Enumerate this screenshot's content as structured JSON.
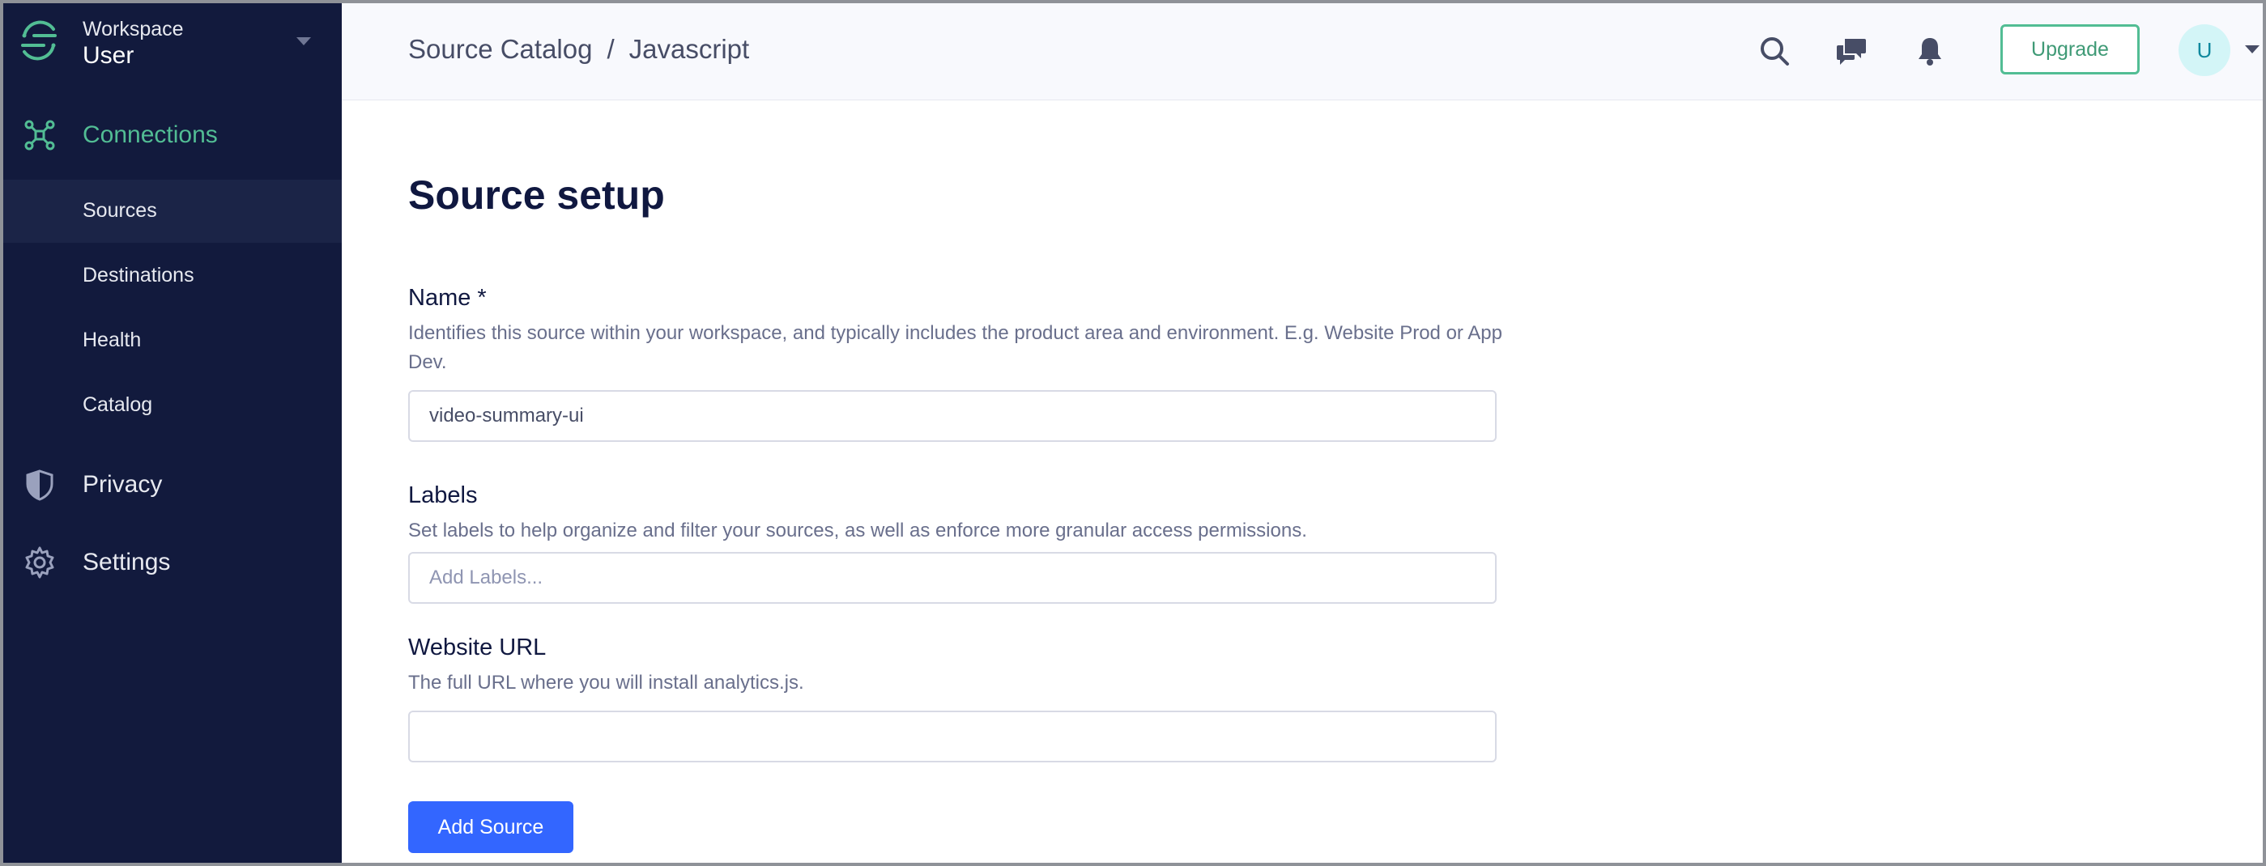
{
  "colors": {
    "sidebar_bg": "#121a3d",
    "active_green": "#52bd94",
    "primary_blue": "#3366ff",
    "text_dark": "#101840",
    "text_muted": "#696f8c"
  },
  "workspace": {
    "kicker": "Workspace",
    "name": "User",
    "logo_icon": "segment-logo-icon",
    "dropdown_icon": "caret-down-icon"
  },
  "sidebar": {
    "items": [
      {
        "label": "Connections",
        "icon": "connections-icon",
        "active": true
      },
      {
        "label": "Sources",
        "sub": true,
        "active": true
      },
      {
        "label": "Destinations",
        "sub": true
      },
      {
        "label": "Health",
        "sub": true
      },
      {
        "label": "Catalog",
        "sub": true
      },
      {
        "label": "Privacy",
        "icon": "shield-icon"
      },
      {
        "label": "Settings",
        "icon": "gear-icon"
      }
    ]
  },
  "header": {
    "breadcrumb": [
      "Source Catalog",
      "/",
      "Javascript"
    ],
    "icons": [
      "search-icon",
      "chat-icon",
      "bell-icon"
    ],
    "upgrade_label": "Upgrade",
    "avatar_initial": "U"
  },
  "form": {
    "title": "Source setup",
    "name_label": "Name *",
    "name_desc": "Identifies this source within your workspace, and typically includes the product area and environment. E.g. Website Prod or App Dev.",
    "name_value": "video-summary-ui",
    "labels_label": "Labels",
    "labels_desc": "Set labels to help organize and filter your sources, as well as enforce more granular access permissions.",
    "labels_placeholder": "Add Labels...",
    "url_label": "Website URL",
    "url_desc": "The full URL where you will install analytics.js.",
    "url_value": "",
    "submit_label": "Add Source"
  }
}
